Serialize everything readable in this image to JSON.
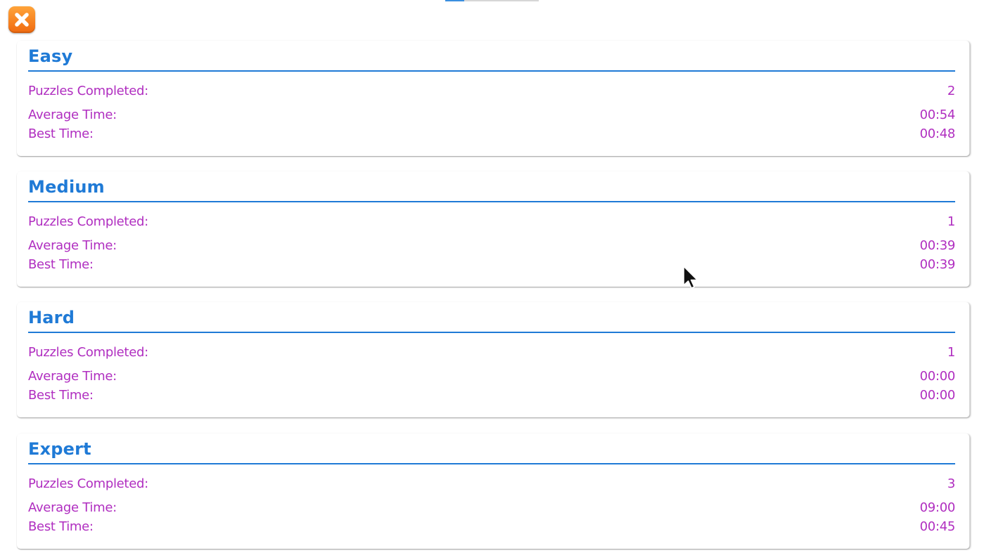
{
  "close_button": {
    "icon": "close-icon",
    "accent_color": "#f5821f"
  },
  "colors": {
    "title": "#1f7ad6",
    "stat_text": "#b02ec0"
  },
  "stats": [
    {
      "title": "Easy",
      "puzzles_completed_label": "Puzzles Completed:",
      "puzzles_completed": "2",
      "average_time_label": "Average Time:",
      "average_time": "00:54",
      "best_time_label": "Best Time:",
      "best_time": "00:48"
    },
    {
      "title": "Medium",
      "puzzles_completed_label": "Puzzles Completed:",
      "puzzles_completed": "1",
      "average_time_label": "Average Time:",
      "average_time": "00:39",
      "best_time_label": "Best Time:",
      "best_time": "00:39"
    },
    {
      "title": "Hard",
      "puzzles_completed_label": "Puzzles Completed:",
      "puzzles_completed": "1",
      "average_time_label": "Average Time:",
      "average_time": "00:00",
      "best_time_label": "Best Time:",
      "best_time": "00:00"
    },
    {
      "title": "Expert",
      "puzzles_completed_label": "Puzzles Completed:",
      "puzzles_completed": "3",
      "average_time_label": "Average Time:",
      "average_time": "09:00",
      "best_time_label": "Best Time:",
      "best_time": "00:45"
    }
  ]
}
